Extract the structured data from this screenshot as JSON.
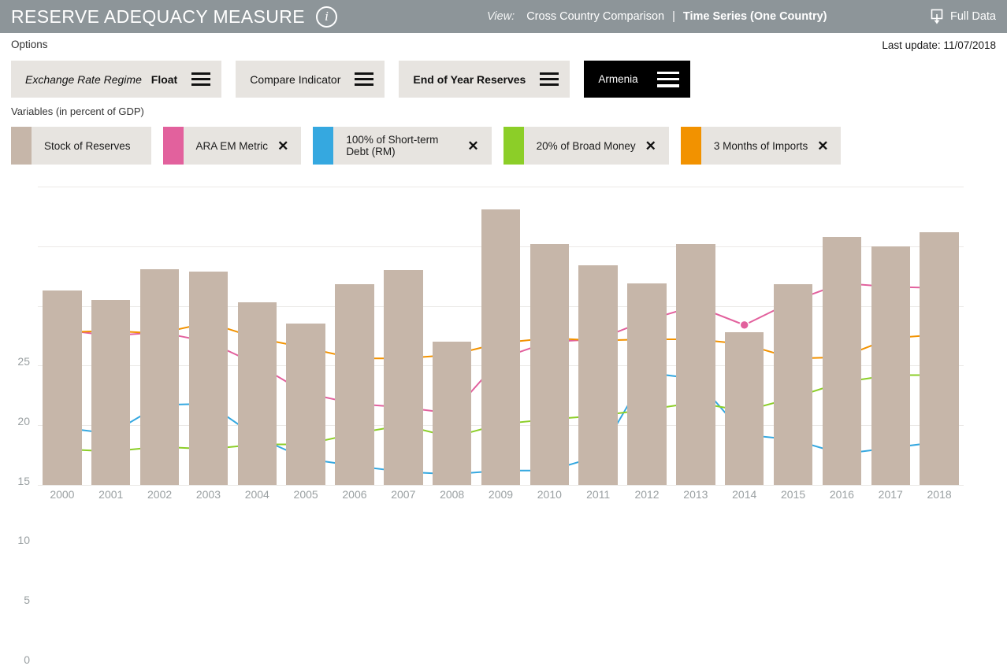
{
  "header": {
    "title": "RESERVE ADEQUACY MEASURE",
    "info_icon": "i",
    "view_label": "View:",
    "view_options": [
      {
        "label": "Cross Country Comparison",
        "active": false
      },
      {
        "label": "Time Series (One Country)",
        "active": true
      }
    ],
    "view_separator": "|",
    "full_data_label": "Full Data"
  },
  "options": {
    "label": "Options",
    "last_update": "Last update: 11/07/2018",
    "buttons": [
      {
        "name": "exchange-rate-regime",
        "italic_text": "Exchange Rate Regime",
        "bold_text": "Float",
        "dark": false
      },
      {
        "name": "compare-indicator",
        "italic_text": "",
        "plain_text": "Compare Indicator",
        "dark": false
      },
      {
        "name": "end-of-year-reserves",
        "bold_text": "End of Year Reserves",
        "dark": false
      },
      {
        "name": "country-selector",
        "plain_text": "Armenia",
        "dark": true
      }
    ]
  },
  "variables": {
    "label": "Variables (in percent of GDP)",
    "items": [
      {
        "label": "Stock of Reserves",
        "color": "#c6b6a9",
        "closable": false
      },
      {
        "label": "ARA EM Metric",
        "color": "#e2619d",
        "closable": true,
        "close": "✕"
      },
      {
        "label": "100% of Short-term Debt (RM)",
        "color": "#35a8e0",
        "closable": true,
        "close": "✕"
      },
      {
        "label": "20% of Broad Money",
        "color": "#8cce28",
        "closable": true,
        "close": "✕"
      },
      {
        "label": "3 Months of Imports",
        "color": "#f29200",
        "closable": true,
        "close": "✕"
      }
    ]
  },
  "chart_data": {
    "type": "bar",
    "title": "",
    "xlabel": "",
    "ylabel": "",
    "ylim": [
      0,
      25
    ],
    "yticks": [
      0,
      5,
      10,
      15,
      20,
      25
    ],
    "grid": true,
    "legend_position": "top",
    "categories": [
      "2000",
      "2001",
      "2002",
      "2003",
      "2004",
      "2005",
      "2006",
      "2007",
      "2008",
      "2009",
      "2010",
      "2011",
      "2012",
      "2013",
      "2014",
      "2015",
      "2016",
      "2017",
      "2018"
    ],
    "series": [
      {
        "name": "Stock of Reserves",
        "type": "bar",
        "color": "#c6b6a9",
        "values": [
          16.3,
          15.5,
          18.1,
          17.9,
          15.3,
          13.5,
          16.8,
          18.0,
          12.0,
          23.1,
          20.2,
          18.4,
          16.9,
          20.2,
          12.8,
          16.8,
          20.8,
          20.0,
          21.2
        ]
      },
      {
        "name": "ARA EM Metric",
        "type": "line",
        "color": "#e2619d",
        "values": [
          13.0,
          12.5,
          12.8,
          12.0,
          10.1,
          7.7,
          6.8,
          6.5,
          6.0,
          10.6,
          12.0,
          12.2,
          13.8,
          15.0,
          13.4,
          15.4,
          16.9,
          16.6,
          16.5
        ]
      },
      {
        "name": "100% of Short-term Debt (RM)",
        "type": "line",
        "color": "#35a8e0",
        "values": [
          4.8,
          4.3,
          6.7,
          6.8,
          4.0,
          2.2,
          1.6,
          1.1,
          0.9,
          1.2,
          1.2,
          2.4,
          9.4,
          8.9,
          4.2,
          3.8,
          2.6,
          3.1,
          3.6
        ]
      },
      {
        "name": "20% of Broad Money",
        "type": "line",
        "color": "#8cce28",
        "values": [
          3.0,
          2.8,
          3.2,
          3.0,
          3.4,
          3.4,
          4.3,
          5.0,
          4.0,
          5.1,
          5.5,
          5.8,
          6.3,
          6.9,
          6.2,
          7.3,
          8.6,
          9.2,
          9.2
        ]
      },
      {
        "name": "3 Months of Imports",
        "type": "line",
        "color": "#f29200",
        "values": [
          12.8,
          12.9,
          12.7,
          13.6,
          12.3,
          11.5,
          10.6,
          10.6,
          10.9,
          11.9,
          12.3,
          12.1,
          12.2,
          12.2,
          11.8,
          10.6,
          10.7,
          12.3,
          12.6
        ]
      }
    ]
  }
}
